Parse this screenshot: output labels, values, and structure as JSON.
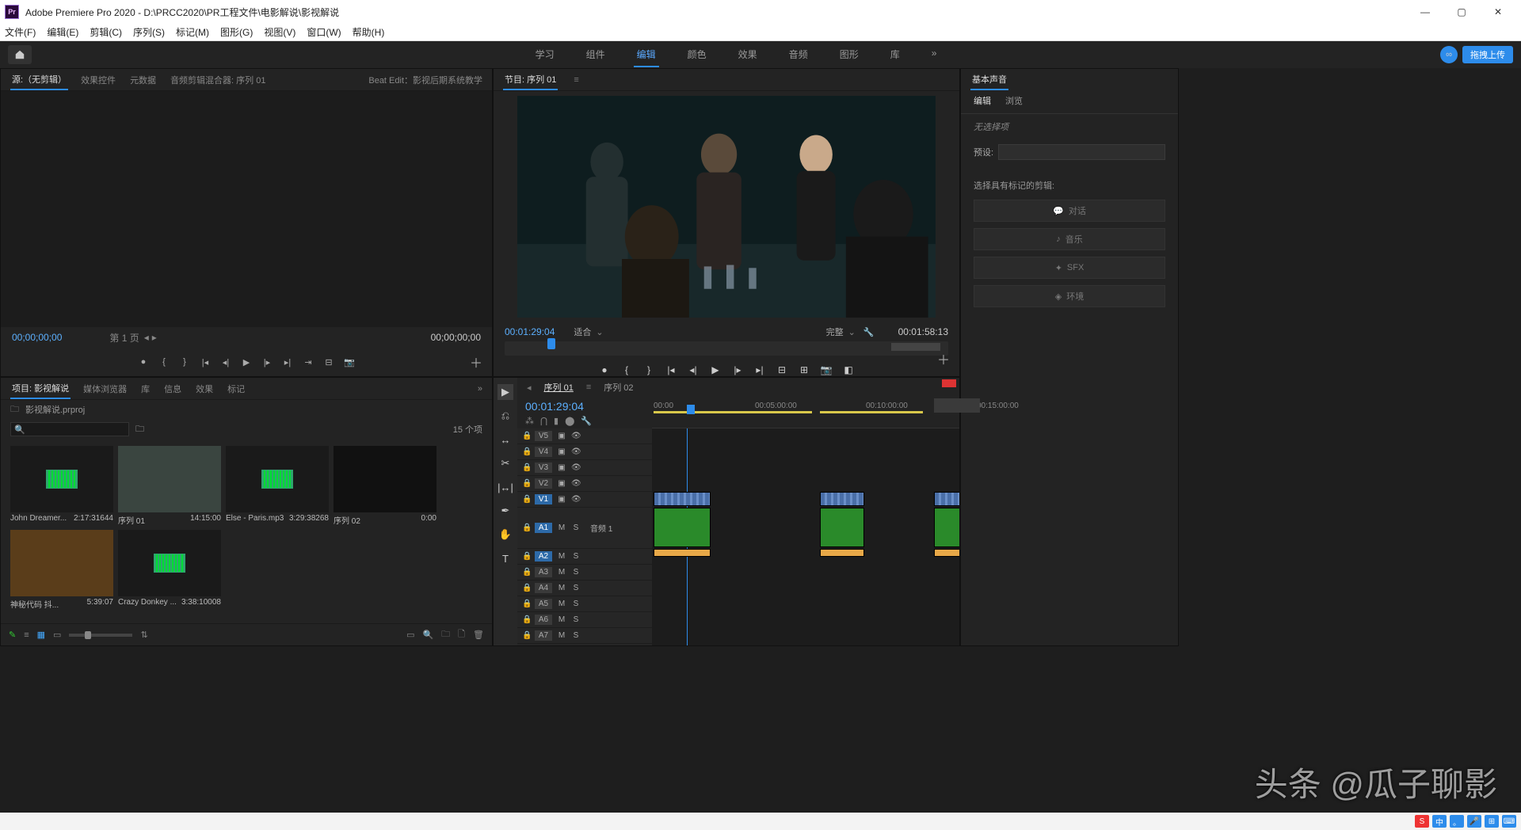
{
  "title": "Adobe Premiere Pro 2020 - D:\\PRCC2020\\PR工程文件\\电影解说\\影视解说",
  "menu": [
    "文件(F)",
    "编辑(E)",
    "剪辑(C)",
    "序列(S)",
    "标记(M)",
    "图形(G)",
    "视图(V)",
    "窗口(W)",
    "帮助(H)"
  ],
  "workspaces": {
    "items": [
      "学习",
      "组件",
      "编辑",
      "颜色",
      "效果",
      "音频",
      "图形",
      "库"
    ],
    "active": "编辑",
    "more": "»",
    "cloud": "拖拽上传"
  },
  "source": {
    "tabs": [
      "源:（无剪辑）",
      "效果控件",
      "元数据",
      "音频剪辑混合器: 序列 01"
    ],
    "active": "源:（无剪辑）",
    "beat": "Beat Edit：影视后期系统教学",
    "tc_left": "00;00;00;00",
    "page": "第 1 页",
    "tc_right": "00;00;00;00"
  },
  "program": {
    "tab": "节目: 序列 01",
    "tc_left": "00:01:29:04",
    "fit": "适合",
    "full": "完整",
    "tc_right": "00:01:58:13"
  },
  "ess": {
    "title": "基本声音",
    "subtabs": [
      "编辑",
      "浏览"
    ],
    "active": "编辑",
    "nosel": "无选择项",
    "preset": "预设:",
    "hint": "选择具有标记的剪辑:",
    "btns": [
      "对话",
      "音乐",
      "SFX",
      "环境"
    ]
  },
  "project": {
    "tabs": [
      "项目: 影视解说",
      "媒体浏览器",
      "库",
      "信息",
      "效果",
      "标记"
    ],
    "active": "项目: 影视解说",
    "more": "»",
    "file": "影视解说.prproj",
    "count": "15 个项",
    "items": [
      {
        "name": "John Dreamer...",
        "dur": "2:17:31644",
        "type": "audio"
      },
      {
        "name": "序列 01",
        "dur": "14:15:00",
        "type": "video"
      },
      {
        "name": "Else - Paris.mp3",
        "dur": "3:29:38268",
        "type": "audio"
      },
      {
        "name": "序列 02",
        "dur": "0:00",
        "type": "black"
      },
      {
        "name": "神秘代码 抖...",
        "dur": "5:39:07",
        "type": "poster"
      },
      {
        "name": "Crazy Donkey ...",
        "dur": "3:38:10008",
        "type": "audio"
      }
    ]
  },
  "timeline": {
    "tabs": [
      "序列 01",
      "序列 02"
    ],
    "active": "序列 01",
    "tc": "00:01:29:04",
    "ruler": [
      "00:00",
      "00:05:00:00",
      "00:10:00:00",
      "00:15:00:00"
    ],
    "vtracks": [
      "V5",
      "V4",
      "V3",
      "V2",
      "V1"
    ],
    "atracks": [
      "A1",
      "A2",
      "A3",
      "A4",
      "A5",
      "A6",
      "A7"
    ],
    "a1label": "音频 1",
    "cliplabel": "音频 1"
  },
  "watermark": "头条 @瓜子聊影",
  "ime": [
    "S",
    "中",
    "。",
    "",
    "",
    ""
  ]
}
